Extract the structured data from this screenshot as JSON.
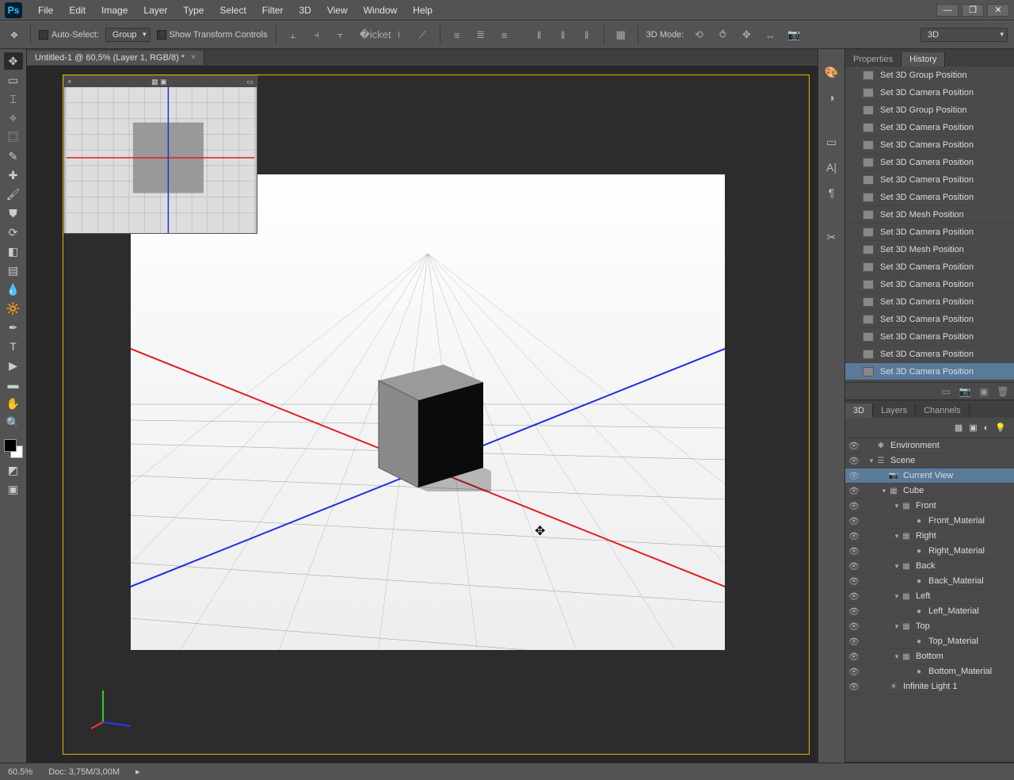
{
  "app": {
    "logo": "Ps"
  },
  "menu": [
    "File",
    "Edit",
    "Image",
    "Layer",
    "Type",
    "Select",
    "Filter",
    "3D",
    "View",
    "Window",
    "Help"
  ],
  "options": {
    "auto_select_label": "Auto-Select:",
    "group_dropdown": "Group",
    "show_transform_label": "Show Transform Controls",
    "mode_label": "3D Mode:",
    "mode_dropdown": "3D"
  },
  "doc": {
    "tab_title": "Untitled-1 @ 60,5% (Layer 1, RGB/8) *"
  },
  "panels": {
    "top": {
      "tabs": [
        "Properties",
        "History"
      ],
      "active": 1
    },
    "bottom": {
      "tabs": [
        "3D",
        "Layers",
        "Channels"
      ],
      "active": 0
    }
  },
  "history": [
    "Set 3D Group Position",
    "Set 3D Camera Position",
    "Set 3D Group Position",
    "Set 3D Camera Position",
    "Set 3D Camera Position",
    "Set 3D Camera Position",
    "Set 3D Camera Position",
    "Set 3D Camera Position",
    "Set 3D Mesh Position",
    "Set 3D Camera Position",
    "Set 3D Mesh Position",
    "Set 3D Camera Position",
    "Set 3D Camera Position",
    "Set 3D Camera Position",
    "Set 3D Camera Position",
    "Set 3D Camera Position",
    "Set 3D Camera Position",
    "Set 3D Camera Position"
  ],
  "history_selected_index": 17,
  "scene": [
    {
      "label": "Environment",
      "indent": 0,
      "icon": "env",
      "tw": ""
    },
    {
      "label": "Scene",
      "indent": 0,
      "icon": "scene",
      "tw": "▾"
    },
    {
      "label": "Current View",
      "indent": 1,
      "icon": "cam",
      "tw": "",
      "sel": true
    },
    {
      "label": "Cube",
      "indent": 1,
      "icon": "mesh",
      "tw": "▾"
    },
    {
      "label": "Front",
      "indent": 2,
      "icon": "mesh",
      "tw": "▾"
    },
    {
      "label": "Front_Material",
      "indent": 3,
      "icon": "mat",
      "tw": ""
    },
    {
      "label": "Right",
      "indent": 2,
      "icon": "mesh",
      "tw": "▾"
    },
    {
      "label": "Right_Material",
      "indent": 3,
      "icon": "mat",
      "tw": ""
    },
    {
      "label": "Back",
      "indent": 2,
      "icon": "mesh",
      "tw": "▾"
    },
    {
      "label": "Back_Material",
      "indent": 3,
      "icon": "mat",
      "tw": ""
    },
    {
      "label": "Left",
      "indent": 2,
      "icon": "mesh",
      "tw": "▾"
    },
    {
      "label": "Left_Material",
      "indent": 3,
      "icon": "mat",
      "tw": ""
    },
    {
      "label": "Top",
      "indent": 2,
      "icon": "mesh",
      "tw": "▾"
    },
    {
      "label": "Top_Material",
      "indent": 3,
      "icon": "mat",
      "tw": ""
    },
    {
      "label": "Bottom",
      "indent": 2,
      "icon": "mesh",
      "tw": "▾"
    },
    {
      "label": "Bottom_Material",
      "indent": 3,
      "icon": "mat",
      "tw": ""
    },
    {
      "label": "Infinite Light 1",
      "indent": 1,
      "icon": "light",
      "tw": ""
    }
  ],
  "status": {
    "zoom": "60.5%",
    "doc_info": "Doc: 3,75M/3,00M"
  }
}
